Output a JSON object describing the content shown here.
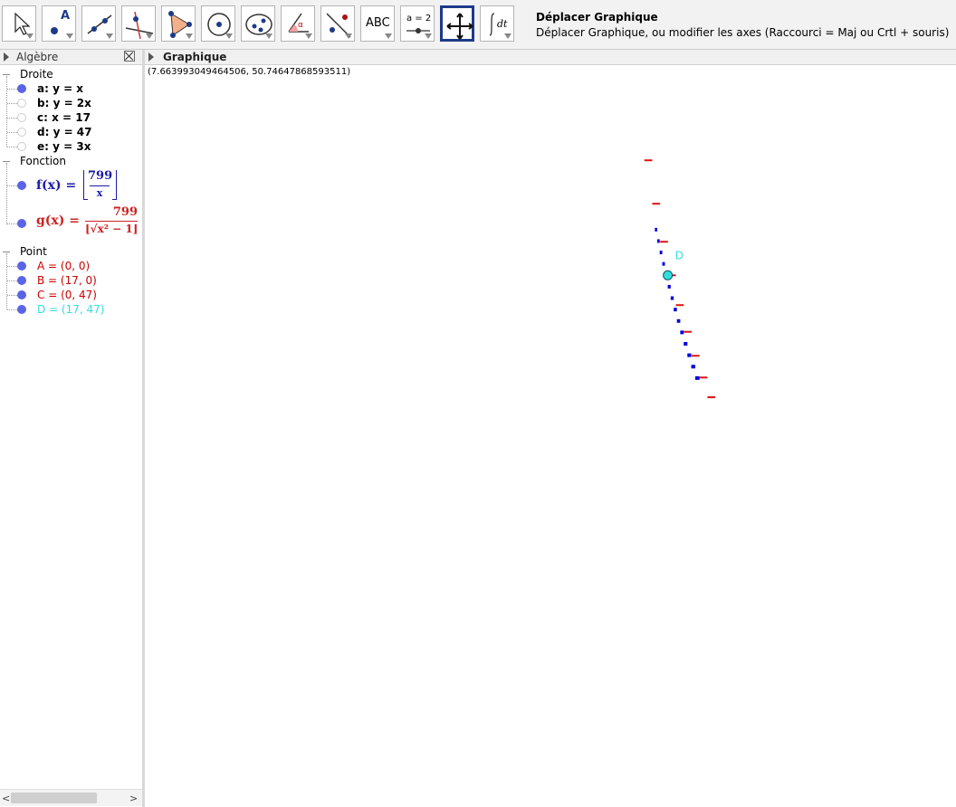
{
  "toolbar": {
    "tools": [
      {
        "name": "move-tool",
        "icon": "arrow-cursor-icon"
      },
      {
        "name": "point-tool",
        "icon": "point-icon",
        "glyph": "A"
      },
      {
        "name": "line-tool",
        "icon": "line-through-points-icon"
      },
      {
        "name": "perpendicular-tool",
        "icon": "perpendicular-line-icon"
      },
      {
        "name": "polygon-tool",
        "icon": "polygon-icon"
      },
      {
        "name": "circle-tool",
        "icon": "circle-center-point-icon"
      },
      {
        "name": "conic-tool",
        "icon": "ellipse-icon"
      },
      {
        "name": "angle-tool",
        "icon": "angle-icon",
        "glyph": "α"
      },
      {
        "name": "reflect-tool",
        "icon": "reflect-about-line-icon"
      },
      {
        "name": "text-tool",
        "icon": "text-icon",
        "glyph": "ABC"
      },
      {
        "name": "slider-tool",
        "icon": "slider-icon",
        "glyph": "a = 2"
      },
      {
        "name": "move-graphics-tool",
        "icon": "move-graphics-view-icon"
      },
      {
        "name": "cas-tool",
        "icon": "integral-icon",
        "glyph": "dt"
      }
    ],
    "selected_index": 11,
    "help_title": "Déplacer Graphique",
    "help_text": "Déplacer Graphique, ou modifier les axes (Raccourci = Maj ou Crtl + souris)"
  },
  "algebra": {
    "title": "Algèbre",
    "categories": [
      {
        "label": "Droite",
        "items": [
          {
            "text": "a: y = x",
            "visible": true,
            "color": "#000000"
          },
          {
            "text": "b: y = 2x",
            "visible": false,
            "color": "#000000"
          },
          {
            "text": "c: x = 17",
            "visible": false,
            "color": "#000000"
          },
          {
            "text": "d: y = 47",
            "visible": false,
            "color": "#000000"
          },
          {
            "text": "e: y = 3x",
            "visible": false,
            "color": "#000000"
          }
        ]
      },
      {
        "label": "Fonction",
        "items": [
          {
            "text_lhs": "f(x) =",
            "numerator": "799",
            "denominator": "x",
            "color": "#1a1aa6",
            "visible": true
          },
          {
            "text_lhs": "g(x) =",
            "numerator": "799",
            "denominator": "⌊√x² − 1⌋",
            "color": "#cc2222",
            "visible": true
          }
        ]
      },
      {
        "label": "Point",
        "items": [
          {
            "text": "A = (0, 0)",
            "visible": true,
            "color": "#cc0000"
          },
          {
            "text": "B = (17, 0)",
            "visible": true,
            "color": "#cc0000"
          },
          {
            "text": "C = (0, 47)",
            "visible": true,
            "color": "#cc0000"
          },
          {
            "text": "D = (17, 47)",
            "visible": true,
            "color": "#33dddd"
          }
        ]
      }
    ]
  },
  "graphics": {
    "title": "Graphique",
    "coords_readout": "(7.663993049464506, 50.74647868593511)",
    "point_label": "D",
    "colors": {
      "f": "#0000dd",
      "g": "#dd1111",
      "point": "#33dddd"
    }
  }
}
